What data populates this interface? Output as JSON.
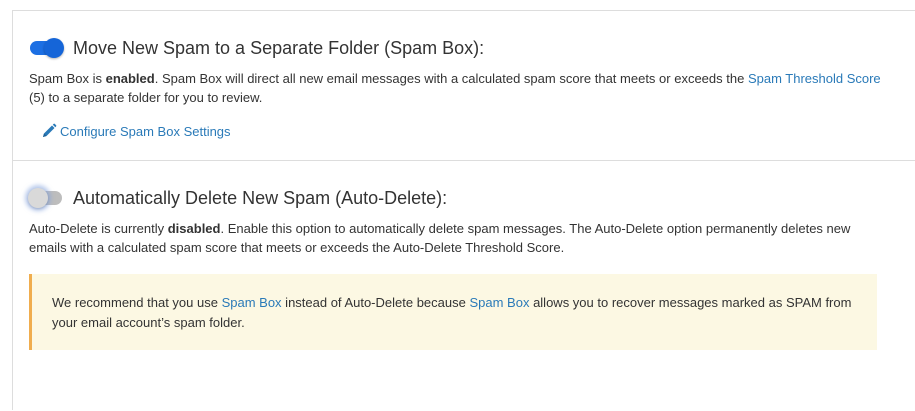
{
  "spam_box": {
    "enabled": true,
    "heading": "Move New Spam to a Separate Folder (Spam Box):",
    "desc_prefix": "Spam Box is ",
    "desc_state": "enabled",
    "desc_middle": ". Spam Box will direct all new email messages with a calculated spam score that meets or exceeds the ",
    "desc_link": "Spam Threshold Score",
    "desc_suffix": " (5) to a separate folder for you to review.",
    "configure_link": "Configure Spam Box Settings",
    "configure_icon": "pencil-icon",
    "toggle_color": "#1c6fe3"
  },
  "auto_delete": {
    "enabled": false,
    "heading": "Automatically Delete New Spam (Auto-Delete):",
    "desc_prefix": "Auto-Delete is currently ",
    "desc_state": "disabled",
    "desc_suffix": ". Enable this option to automatically delete spam messages. The Auto-Delete option permanently deletes new emails with a calculated spam score that meets or exceeds the Auto-Delete Threshold Score.",
    "alert": {
      "text_1": "We recommend that you use ",
      "link_1": "Spam Box",
      "text_2": " instead of Auto-Delete because ",
      "link_2": "Spam Box",
      "text_3": " allows you to recover messages marked as SPAM from your email account’s spam folder.",
      "background": "#fcf8e3",
      "border_color": "#f0ad4e"
    }
  }
}
